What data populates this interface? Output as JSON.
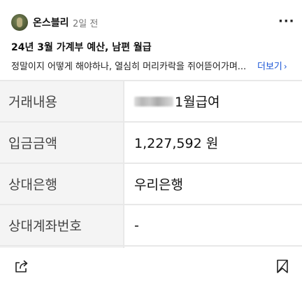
{
  "post": {
    "author": "온스블리",
    "time": "2일 전",
    "more_icon": "more-horizontal-icon",
    "title": "24년 3월 가계부 예산, 남편 월급",
    "preview": "정말이지 어떻게 해야하나, 열심히 머리카락을 쥐어뜯어가며...",
    "see_more": "더보기"
  },
  "table": {
    "rows": [
      {
        "label": "거래내용",
        "value": "1월급여",
        "redacted": true
      },
      {
        "label": "입금금액",
        "value": "1,227,592 원"
      },
      {
        "label": "상대은행",
        "value": "우리은행"
      },
      {
        "label": "상대계좌번호",
        "value": "-"
      }
    ]
  },
  "footer": {
    "share_icon": "share-icon",
    "bookmark_icon": "bookmark-icon"
  },
  "colors": {
    "link": "#1a55d6",
    "label_bg": "#f4f4f4",
    "grid_line": "#e8e8e8"
  }
}
